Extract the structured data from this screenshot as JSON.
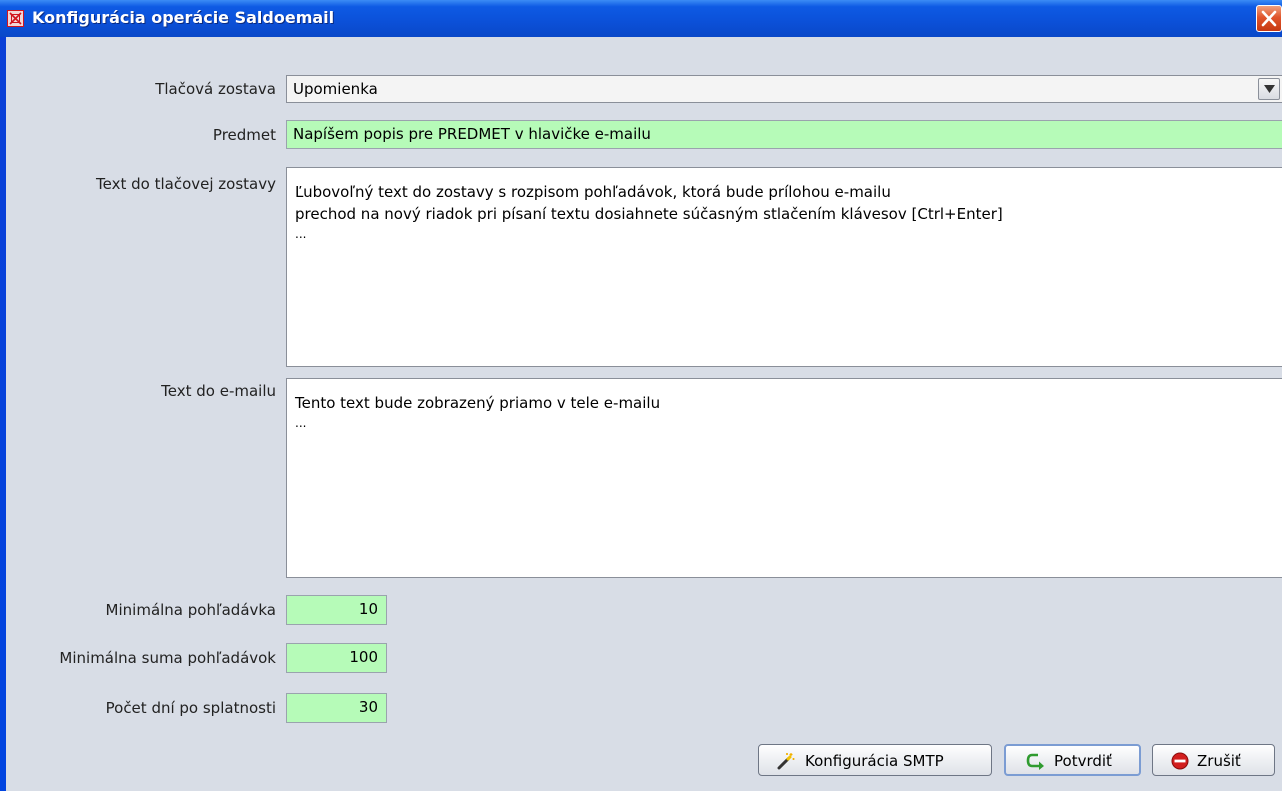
{
  "window": {
    "title": "Konfigurácia operácie Saldoemail",
    "icons": {
      "app": "app-icon",
      "close": "close-icon"
    }
  },
  "form": {
    "report_label": "Tlačová zostava",
    "report_value": "Upomienka",
    "subject_label": "Predmet",
    "subject_value": "Napíšem popis pre PREDMET v hlavičke e-mailu",
    "report_text_label": "Text do tlačovej zostavy",
    "report_text_lines": [
      "Ľubovoľný text do zostavy s rozpisom pohľadávok, ktorá bude prílohou e-mailu",
      "prechod na nový riadok pri písaní textu dosiahnete súčasným stlačením klávesov  [Ctrl+Enter]",
      "..."
    ],
    "email_text_label": "Text do e-mailu",
    "email_text_lines": [
      "Tento text bude zobrazený priamo v tele e-mailu",
      "..."
    ],
    "min_claim_label": "Minimálna pohľadávka",
    "min_claim_value": "10",
    "min_sum_label": "Minimálna suma pohľadávok",
    "min_sum_value": "100",
    "days_label": "Počet dní po splatnosti",
    "days_value": "30"
  },
  "buttons": {
    "smtp_label": "Konfigurácia SMTP",
    "confirm_label": "Potvrdiť",
    "cancel_label": "Zrušiť"
  },
  "colors": {
    "titlebar": "#0b50d8",
    "client_bg": "#d8dde6",
    "field_highlight": "#b6fbb8",
    "close_button": "#e0552c"
  }
}
